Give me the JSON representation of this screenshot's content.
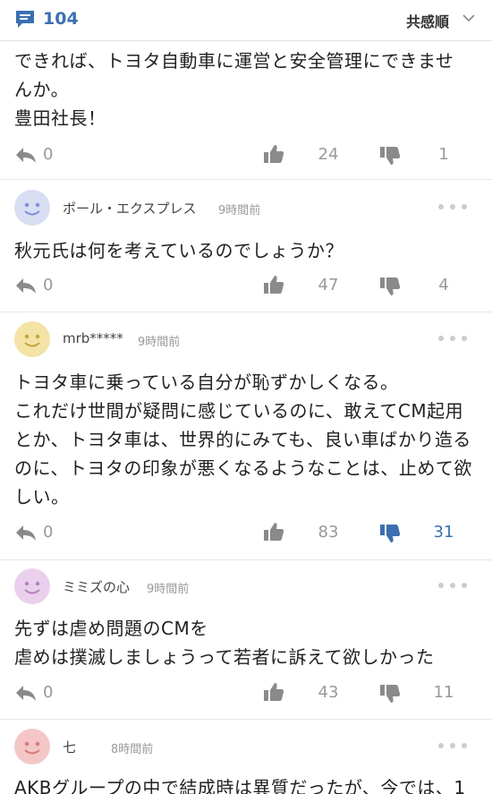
{
  "header": {
    "comment_count": "104",
    "sort_label": "共感順"
  },
  "partial_comment": {
    "lines": [
      "できれば、トヨタ自動車に運営と安全管理にできませ",
      "んか。",
      "豊田社長！"
    ],
    "replies": "0",
    "likes": "24",
    "dislikes": "1"
  },
  "comments": [
    {
      "username": "ポール・エクスプレス",
      "time": "9時間前",
      "avatar_color": "#d9def2",
      "face_color": "#7d8fd8",
      "lines": [
        "秋元氏は何を考えているのでしょうか？"
      ],
      "replies": "0",
      "likes": "47",
      "dislikes": "4"
    },
    {
      "username": "mrb*****",
      "time": "9時間前",
      "avatar_color": "#f3e3a5",
      "face_color": "#c9a23a",
      "lines": [
        "トヨタ車に乗っている自分が恥ずかしくなる。",
        "これだけ世間が疑問に感じているのに、敢えてCM起用",
        "とか、トヨタ車は、世界的にみても、良い車ばかり造る",
        "のに、トヨタの印象が悪くなるようなことは、止めて欲",
        "しい。"
      ],
      "replies": "0",
      "likes": "83",
      "dislikes": "31",
      "dislike_active": true
    },
    {
      "username": "ミミズの心",
      "time": "9時間前",
      "avatar_color": "#ead0ec",
      "face_color": "#b77fc0",
      "lines": [
        "先ずは虐め問題のCMを",
        "虐めは撲滅しましょうって若者に訴えて欲しかった"
      ],
      "replies": "0",
      "likes": "43",
      "dislikes": "11"
    },
    {
      "username": "七",
      "time": "8時間前",
      "avatar_color": "#f4c6c6",
      "face_color": "#d97878",
      "lines": [
        "AKBグループの中で結成時は異質だったが、今では、1"
      ]
    }
  ],
  "colors": {
    "accent": "#3c6fb0",
    "icon_gray": "#8a8a8a",
    "muted_text": "#999999"
  }
}
